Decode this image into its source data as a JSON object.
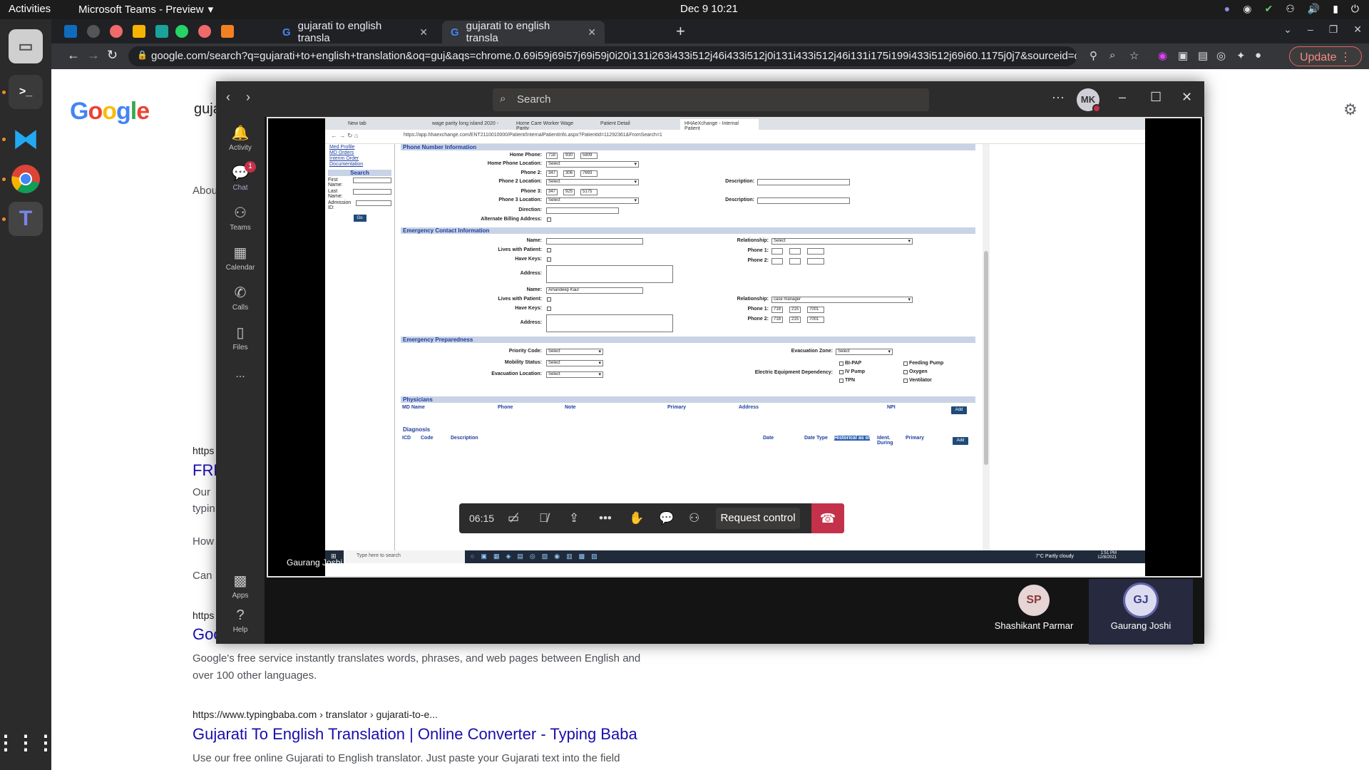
{
  "topbar": {
    "activities": "Activities",
    "app_name": "Microsoft Teams - Preview",
    "clock": "Dec 9  10:21"
  },
  "chrome": {
    "tabs": [
      {
        "label": "gujarati to english transla",
        "active": false
      },
      {
        "label": "gujarati to english transla",
        "active": true
      }
    ],
    "url": "google.com/search?q=gujarati+to+english+translation&oq=guj&aqs=chrome.0.69i59j69i57j69i59j0i20i131i263i433i512j46i433i512j0i131i433i512j46i131i175i199i433i512j69i60.1175j0j7&sourceid=chro...",
    "update_label": "Update"
  },
  "google": {
    "logo": "Google",
    "search_partial": "guja",
    "results": [
      {
        "url": "https",
        "title": "FRE",
        "line1": "Our",
        "line2": "typin"
      },
      {
        "url": "https",
        "title": "Goo",
        "line1": "Google's free service instantly translates words, phrases, and web pages between English and",
        "line2": "over 100 other languages."
      },
      {
        "url": "https://www.typingbaba.com › translator › gujarati-to-e...",
        "title": "Gujarati To English Translation | Online Converter - Typing Baba",
        "line1": "Use our free online Gujarati to English translator. Just paste your Gujarati text into the field",
        "line2": ""
      }
    ],
    "fragments": {
      "how": "How",
      "can": "Can",
      "about": "Abou"
    }
  },
  "teams": {
    "search_placeholder": "Search",
    "avatar_initials": "MK",
    "rail": [
      {
        "label": "Activity",
        "icon": "bell-icon"
      },
      {
        "label": "Chat",
        "icon": "chat-icon",
        "badge": "1"
      },
      {
        "label": "Teams",
        "icon": "teams-icon"
      },
      {
        "label": "Calendar",
        "icon": "calendar-icon"
      },
      {
        "label": "Calls",
        "icon": "phone-icon"
      },
      {
        "label": "Files",
        "icon": "file-icon"
      },
      {
        "label": "...",
        "icon": "more-icon"
      },
      {
        "label": "Apps",
        "icon": "apps-icon"
      },
      {
        "label": "Help",
        "icon": "help-icon"
      }
    ],
    "presenter": "Gaurang Joshi",
    "meeting": {
      "timer": "06:15",
      "request_control": "Request control"
    },
    "participants": [
      {
        "initials": "SP",
        "name": "Shashikant Parmar"
      },
      {
        "initials": "GJ",
        "name": "Gaurang Joshi"
      }
    ]
  },
  "remote": {
    "tabs": [
      "New tab",
      "wage parity long island 2020 - ",
      "Home Care Worker Wage Parity",
      "Patient Detail",
      "HHAeXchange - Internal Patient"
    ],
    "url": "https://app.hhaexchange.com/ENT2110010000/Patient/InternalPatientInfo.aspx?PatientId=11292361&FromSearch=1",
    "nav_links": [
      "Med Profile",
      "MD Orders",
      "Interim Order",
      "Documentation"
    ],
    "search": {
      "heading": "Search",
      "first_name": "First Name:",
      "last_name": "Last Name:",
      "admission_id": "Admission ID:",
      "go": "Go"
    },
    "phone_section": "Phone Number Information",
    "home_phone": {
      "label": "Home Phone:",
      "a": "718",
      "b": "930",
      "c": "5809"
    },
    "home_phone_location": {
      "label": "Home Phone Location:",
      "value": "Select"
    },
    "phone2": {
      "label": "Phone 2:",
      "a": "347",
      "b": "306",
      "c": "7693"
    },
    "phone2_location": {
      "label": "Phone 2 Location:",
      "value": "Select"
    },
    "phone3": {
      "label": "Phone 3:",
      "a": "347",
      "b": "925",
      "c": "5175"
    },
    "phone3_location": {
      "label": "Phone 3 Location:",
      "value": "Select"
    },
    "description": "Description:",
    "direction": "Direction:",
    "alt_billing": "Alternate Billing Address:",
    "emergency_section": "Emergency Contact Information",
    "ec_name": "Name:",
    "ec_lives": "Lives with Patient:",
    "ec_keys": "Have Keys:",
    "ec_address": "Address:",
    "ec_relationship": "Relationship:",
    "ec_phone1": "Phone 1:",
    "ec_phone2": "Phone 2:",
    "ec1_relationship": "Select",
    "ec2_name": "Amandeep Kaur",
    "ec2_relationship": "case manager",
    "ec2_phone1": {
      "a": "718",
      "b": "215",
      "c": "7001"
    },
    "ec2_phone2": {
      "a": "718",
      "b": "215",
      "c": "7001"
    },
    "prep_section": "Emergency Preparedness",
    "priority_code": {
      "label": "Priority Code:",
      "value": "Select"
    },
    "mobility_status": {
      "label": "Mobility Status:",
      "value": "Select"
    },
    "evac_location": {
      "label": "Evacuation Location:",
      "value": "Select"
    },
    "evac_zone": {
      "label": "Evacuation Zone:",
      "value": "Select"
    },
    "equipment": {
      "label": "Electric Equipment Dependency:",
      "items": [
        "BI-PAP",
        "Feeding Pump",
        "IV Pump",
        "Oxygen",
        "TPN",
        "Ventilator"
      ]
    },
    "physicians_section": "Physicians",
    "physicians_cols": [
      "MD Name",
      "Phone",
      "Note",
      "Primary",
      "Address",
      "NPI"
    ],
    "diagnosis_section": "Diagnosis",
    "diagnosis_cols": [
      "ICD",
      "Code",
      "Description",
      "Date",
      "Date Type",
      "Historical as of",
      "Ident. During",
      "Primary"
    ],
    "add": "Add",
    "taskbar": {
      "search": "Type here to search",
      "weather": "7°C  Partly cloudy",
      "time": "1:51 PM",
      "date": "12/8/2021"
    }
  },
  "colors": {
    "teams_accent": "#6264a7",
    "hangup": "#c4314b",
    "hha_header": "#c9d3e6",
    "google_link": "#1a0dab"
  }
}
